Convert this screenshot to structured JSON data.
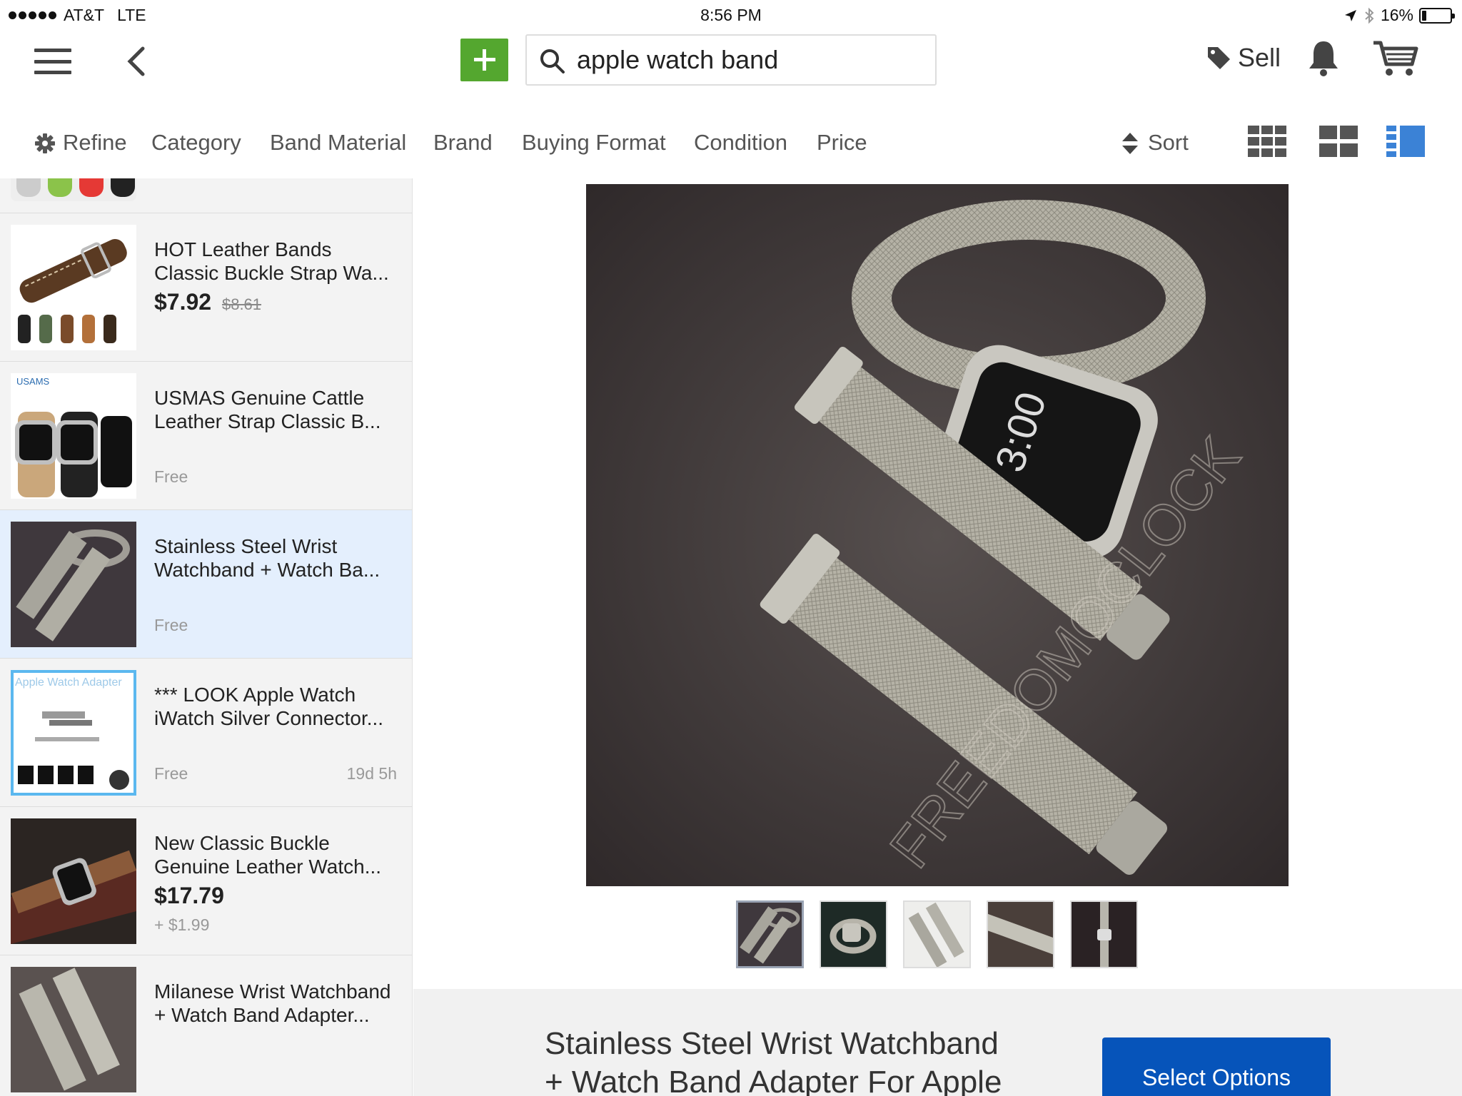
{
  "status_bar": {
    "carrier": "AT&T",
    "network": "LTE",
    "time": "8:56 PM",
    "battery": "16%",
    "battery_level": 0.16
  },
  "nav": {
    "search_value": "apple watch band",
    "sell_label": "Sell"
  },
  "filters": {
    "refine": "Refine",
    "items": [
      "Category",
      "Band Material",
      "Brand",
      "Buying Format",
      "Condition",
      "Price"
    ],
    "sort": "Sort"
  },
  "listings": [
    {
      "title_line1": "HOT Leather Bands",
      "title_line2": "Classic Buckle Strap Wa...",
      "price": "$7.92",
      "old_price": "$8.61"
    },
    {
      "title_line1": "USMAS Genuine Cattle",
      "title_line2": "Leather Strap Classic B...",
      "shipping": "Free",
      "thumb_brand": "USAMS"
    },
    {
      "title_line1": "Stainless Steel Wrist",
      "title_line2": "Watchband + Watch Ba...",
      "shipping": "Free"
    },
    {
      "title_line1": "*** LOOK Apple Watch",
      "title_line2": "iWatch Silver Connector...",
      "shipping": "Free",
      "time_left": "19d 5h",
      "thumb_caption": "Apple Watch Adapter"
    },
    {
      "title_line1": "New Classic Buckle",
      "title_line2": "Genuine Leather Watch...",
      "price": "$17.79",
      "shipping": "+ $1.99"
    },
    {
      "title_line1": "Milanese Wrist Watchband",
      "title_line2": "+ Watch Band Adapter..."
    }
  ],
  "detail": {
    "photo_watch_time": "3:00",
    "photo_watermark": "FREEDOMOCLOCK",
    "title_line1": "Stainless Steel Wrist  Watchband",
    "title_line2": "+ Watch Band Adapter For Apple",
    "select_options": "Select Options",
    "gallery_count": 5,
    "gallery_selected": 1
  },
  "colors": {
    "add_button": "#54a72f",
    "primary_button": "#0654ba",
    "selected_row": "#e4effd",
    "active_view": "#3b82d6"
  }
}
